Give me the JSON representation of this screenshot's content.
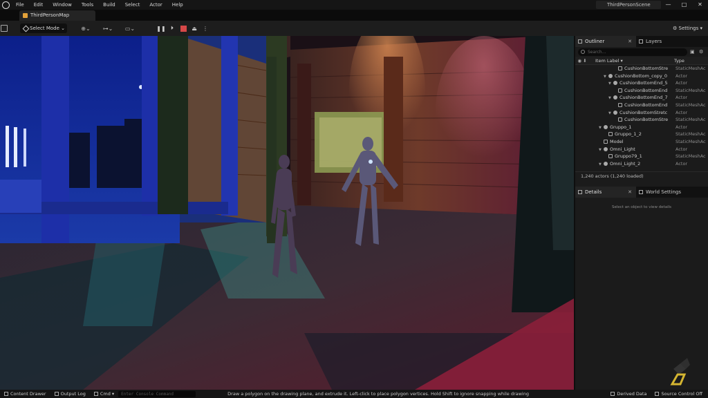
{
  "menu": [
    "File",
    "Edit",
    "Window",
    "Tools",
    "Build",
    "Select",
    "Actor",
    "Help"
  ],
  "window": {
    "scene_title": "ThirdPersonScene",
    "min": "—",
    "max": "□",
    "close": "✕"
  },
  "map_tab": "ThirdPersonMap",
  "toolbar": {
    "select_mode": "Select Mode",
    "settings": "Settings"
  },
  "outliner": {
    "tab_label": "Outliner",
    "close": "✕",
    "layers_tab": "Layers",
    "search_placeholder": "Search...",
    "col_label": "Item Label ▾",
    "col_type": "Type",
    "rows": [
      {
        "name": "CushionBottomStre",
        "type": "StaticMeshAc",
        "indent": 5,
        "kind": "mesh",
        "tri": false
      },
      {
        "name": "CushionBottom_copy_0",
        "type": "Actor",
        "indent": 3,
        "kind": "actor",
        "tri": true
      },
      {
        "name": "CushionBottomEnd_5",
        "type": "Actor",
        "indent": 4,
        "kind": "actor",
        "tri": true
      },
      {
        "name": "CushionBottomEnd",
        "type": "StaticMeshAc",
        "indent": 5,
        "kind": "mesh",
        "tri": false
      },
      {
        "name": "CushionBottomEnd_7",
        "type": "Actor",
        "indent": 4,
        "kind": "actor",
        "tri": true
      },
      {
        "name": "CushionBottomEnd",
        "type": "StaticMeshAc",
        "indent": 5,
        "kind": "mesh",
        "tri": false
      },
      {
        "name": "CushionBottomStretc",
        "type": "Actor",
        "indent": 4,
        "kind": "actor",
        "tri": true
      },
      {
        "name": "CushionBottomStre",
        "type": "StaticMeshAc",
        "indent": 5,
        "kind": "mesh",
        "tri": false
      },
      {
        "name": "Gruppo_1",
        "type": "Actor",
        "indent": 2,
        "kind": "actor",
        "tri": true
      },
      {
        "name": "Gruppo_1_2",
        "type": "StaticMeshAc",
        "indent": 3,
        "kind": "mesh",
        "tri": false
      },
      {
        "name": "Model",
        "type": "StaticMeshAc",
        "indent": 2,
        "kind": "mesh",
        "tri": false
      },
      {
        "name": "Omni_Light",
        "type": "Actor",
        "indent": 2,
        "kind": "actor",
        "tri": true
      },
      {
        "name": "Gruppo79_1",
        "type": "StaticMeshAc",
        "indent": 3,
        "kind": "mesh",
        "tri": false
      },
      {
        "name": "Omni_Light_2",
        "type": "Actor",
        "indent": 2,
        "kind": "actor",
        "tri": true
      }
    ],
    "count": "1,240 actors (1,240 loaded)"
  },
  "details": {
    "tab_label": "Details",
    "close": "✕",
    "world_tab": "World Settings",
    "message": "Select an object to view details"
  },
  "status": {
    "content_drawer": "Content Drawer",
    "output_log": "Output Log",
    "cmd": "Cmd ▾",
    "console_placeholder": "Enter Console Command",
    "hint": "Draw a polygon on the drawing plane, and extrude it. Left-click to place polygon vertices. Hold Shift to ignore snapping while drawing",
    "derived": "Derived Data",
    "source": "Source Control Off"
  },
  "colors": {
    "accent": "#e3a23a",
    "stop": "#d64848",
    "logo": "#d4b531"
  }
}
